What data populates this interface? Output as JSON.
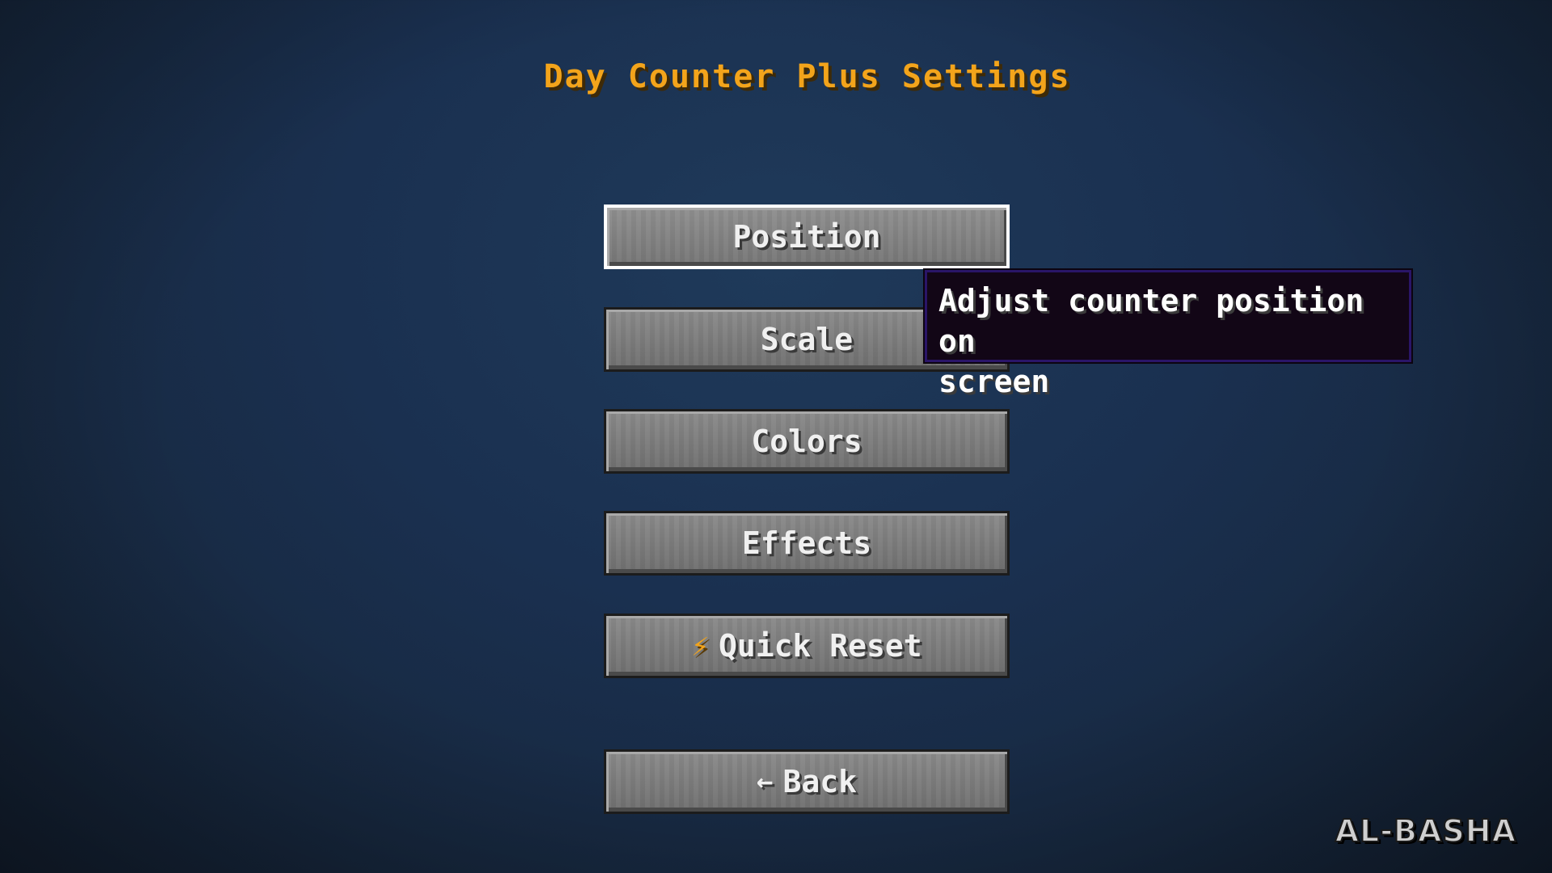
{
  "screen": {
    "title": "Day Counter Plus Settings",
    "title_color": "#f3a41b"
  },
  "buttons": [
    {
      "label": "Position",
      "state": "hovered"
    },
    {
      "label": "Scale"
    },
    {
      "label": "Colors"
    },
    {
      "label": "Effects"
    },
    {
      "label": "Quick Reset",
      "icon": "lightning-bolt-icon",
      "icon_glyph": "⚡"
    },
    {
      "label": "Back",
      "icon": "arrow-left-icon",
      "icon_glyph": "←"
    }
  ],
  "tooltip": {
    "text_line1": "Adjust counter position on",
    "text_line2": "screen"
  },
  "watermark": {
    "text": "AL-BASHA"
  },
  "colors": {
    "background": "#1a3050",
    "button_face": "#7c7c7c",
    "tooltip_bg": "#120616",
    "tooltip_border": "#2a1568"
  }
}
